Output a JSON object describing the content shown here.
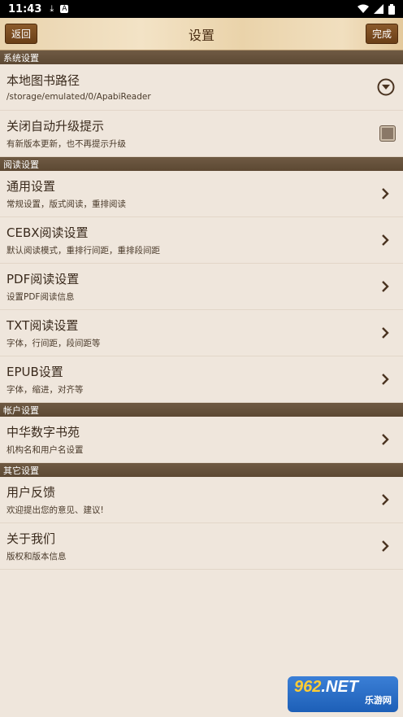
{
  "status_bar": {
    "time": "11:43",
    "download_icon": "download-icon",
    "a_icon": "A",
    "right_icons": [
      "wifi-icon",
      "signal-icon",
      "battery-icon"
    ]
  },
  "header": {
    "back_label": "返回",
    "title": "设置",
    "done_label": "完成"
  },
  "sections": {
    "system": "系统设置",
    "reading": "阅读设置",
    "account": "帐户设置",
    "other": "其它设置"
  },
  "system_items": [
    {
      "title": "本地图书路径",
      "subtitle": "/storage/emulated/0/ApabiReader"
    },
    {
      "title": "关闭自动升级提示",
      "subtitle": "有新版本更新，也不再提示升级"
    }
  ],
  "reading_items": [
    {
      "title": "通用设置",
      "subtitle": "常规设置，版式阅读，重排阅读"
    },
    {
      "title": "CEBX阅读设置",
      "subtitle": "默认阅读模式，重排行间距，重排段间距"
    },
    {
      "title": "PDF阅读设置",
      "subtitle": "设置PDF阅读信息"
    },
    {
      "title": "TXT阅读设置",
      "subtitle": "字体，行间距，段间距等"
    },
    {
      "title": "EPUB设置",
      "subtitle": "字体，缩进，对齐等"
    }
  ],
  "account_items": [
    {
      "title": "中华数字书苑",
      "subtitle": "机构名和用户名设置"
    }
  ],
  "other_items": [
    {
      "title": "用户反馈",
      "subtitle": "欢迎提出您的意见、建议!"
    },
    {
      "title": "关于我们",
      "subtitle": "版权和版本信息"
    }
  ],
  "watermark": {
    "brand": "962",
    "suffix": ".NET",
    "caption": "乐游网"
  },
  "colors": {
    "section_bg": "#5c4833",
    "page_bg": "#efe6dc",
    "button_bg": "#6b3f17"
  }
}
